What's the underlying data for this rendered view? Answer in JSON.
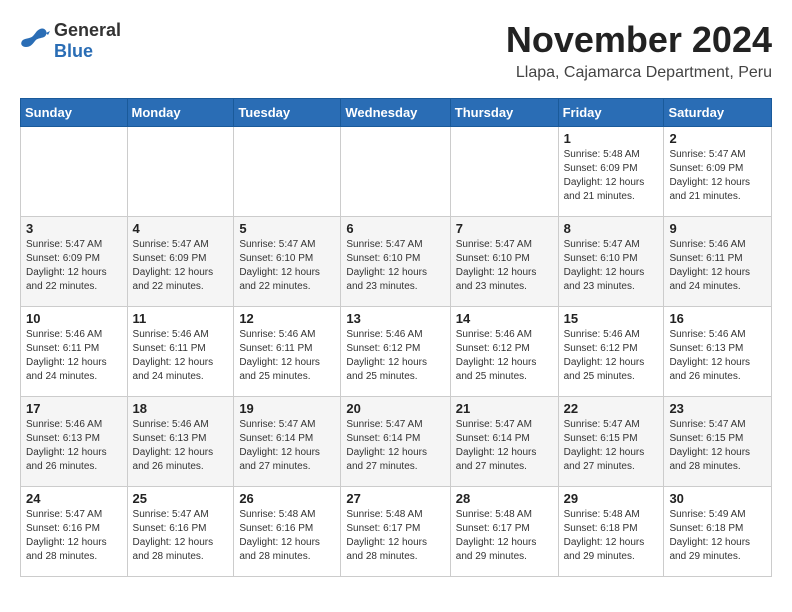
{
  "logo": {
    "general": "General",
    "blue": "Blue"
  },
  "title": {
    "month": "November 2024",
    "location": "Llapa, Cajamarca Department, Peru"
  },
  "weekdays": [
    "Sunday",
    "Monday",
    "Tuesday",
    "Wednesday",
    "Thursday",
    "Friday",
    "Saturday"
  ],
  "weeks": [
    [
      {
        "day": "",
        "info": ""
      },
      {
        "day": "",
        "info": ""
      },
      {
        "day": "",
        "info": ""
      },
      {
        "day": "",
        "info": ""
      },
      {
        "day": "",
        "info": ""
      },
      {
        "day": "1",
        "info": "Sunrise: 5:48 AM\nSunset: 6:09 PM\nDaylight: 12 hours and 21 minutes."
      },
      {
        "day": "2",
        "info": "Sunrise: 5:47 AM\nSunset: 6:09 PM\nDaylight: 12 hours and 21 minutes."
      }
    ],
    [
      {
        "day": "3",
        "info": "Sunrise: 5:47 AM\nSunset: 6:09 PM\nDaylight: 12 hours and 22 minutes."
      },
      {
        "day": "4",
        "info": "Sunrise: 5:47 AM\nSunset: 6:09 PM\nDaylight: 12 hours and 22 minutes."
      },
      {
        "day": "5",
        "info": "Sunrise: 5:47 AM\nSunset: 6:10 PM\nDaylight: 12 hours and 22 minutes."
      },
      {
        "day": "6",
        "info": "Sunrise: 5:47 AM\nSunset: 6:10 PM\nDaylight: 12 hours and 23 minutes."
      },
      {
        "day": "7",
        "info": "Sunrise: 5:47 AM\nSunset: 6:10 PM\nDaylight: 12 hours and 23 minutes."
      },
      {
        "day": "8",
        "info": "Sunrise: 5:47 AM\nSunset: 6:10 PM\nDaylight: 12 hours and 23 minutes."
      },
      {
        "day": "9",
        "info": "Sunrise: 5:46 AM\nSunset: 6:11 PM\nDaylight: 12 hours and 24 minutes."
      }
    ],
    [
      {
        "day": "10",
        "info": "Sunrise: 5:46 AM\nSunset: 6:11 PM\nDaylight: 12 hours and 24 minutes."
      },
      {
        "day": "11",
        "info": "Sunrise: 5:46 AM\nSunset: 6:11 PM\nDaylight: 12 hours and 24 minutes."
      },
      {
        "day": "12",
        "info": "Sunrise: 5:46 AM\nSunset: 6:11 PM\nDaylight: 12 hours and 25 minutes."
      },
      {
        "day": "13",
        "info": "Sunrise: 5:46 AM\nSunset: 6:12 PM\nDaylight: 12 hours and 25 minutes."
      },
      {
        "day": "14",
        "info": "Sunrise: 5:46 AM\nSunset: 6:12 PM\nDaylight: 12 hours and 25 minutes."
      },
      {
        "day": "15",
        "info": "Sunrise: 5:46 AM\nSunset: 6:12 PM\nDaylight: 12 hours and 25 minutes."
      },
      {
        "day": "16",
        "info": "Sunrise: 5:46 AM\nSunset: 6:13 PM\nDaylight: 12 hours and 26 minutes."
      }
    ],
    [
      {
        "day": "17",
        "info": "Sunrise: 5:46 AM\nSunset: 6:13 PM\nDaylight: 12 hours and 26 minutes."
      },
      {
        "day": "18",
        "info": "Sunrise: 5:46 AM\nSunset: 6:13 PM\nDaylight: 12 hours and 26 minutes."
      },
      {
        "day": "19",
        "info": "Sunrise: 5:47 AM\nSunset: 6:14 PM\nDaylight: 12 hours and 27 minutes."
      },
      {
        "day": "20",
        "info": "Sunrise: 5:47 AM\nSunset: 6:14 PM\nDaylight: 12 hours and 27 minutes."
      },
      {
        "day": "21",
        "info": "Sunrise: 5:47 AM\nSunset: 6:14 PM\nDaylight: 12 hours and 27 minutes."
      },
      {
        "day": "22",
        "info": "Sunrise: 5:47 AM\nSunset: 6:15 PM\nDaylight: 12 hours and 27 minutes."
      },
      {
        "day": "23",
        "info": "Sunrise: 5:47 AM\nSunset: 6:15 PM\nDaylight: 12 hours and 28 minutes."
      }
    ],
    [
      {
        "day": "24",
        "info": "Sunrise: 5:47 AM\nSunset: 6:16 PM\nDaylight: 12 hours and 28 minutes."
      },
      {
        "day": "25",
        "info": "Sunrise: 5:47 AM\nSunset: 6:16 PM\nDaylight: 12 hours and 28 minutes."
      },
      {
        "day": "26",
        "info": "Sunrise: 5:48 AM\nSunset: 6:16 PM\nDaylight: 12 hours and 28 minutes."
      },
      {
        "day": "27",
        "info": "Sunrise: 5:48 AM\nSunset: 6:17 PM\nDaylight: 12 hours and 28 minutes."
      },
      {
        "day": "28",
        "info": "Sunrise: 5:48 AM\nSunset: 6:17 PM\nDaylight: 12 hours and 29 minutes."
      },
      {
        "day": "29",
        "info": "Sunrise: 5:48 AM\nSunset: 6:18 PM\nDaylight: 12 hours and 29 minutes."
      },
      {
        "day": "30",
        "info": "Sunrise: 5:49 AM\nSunset: 6:18 PM\nDaylight: 12 hours and 29 minutes."
      }
    ]
  ]
}
